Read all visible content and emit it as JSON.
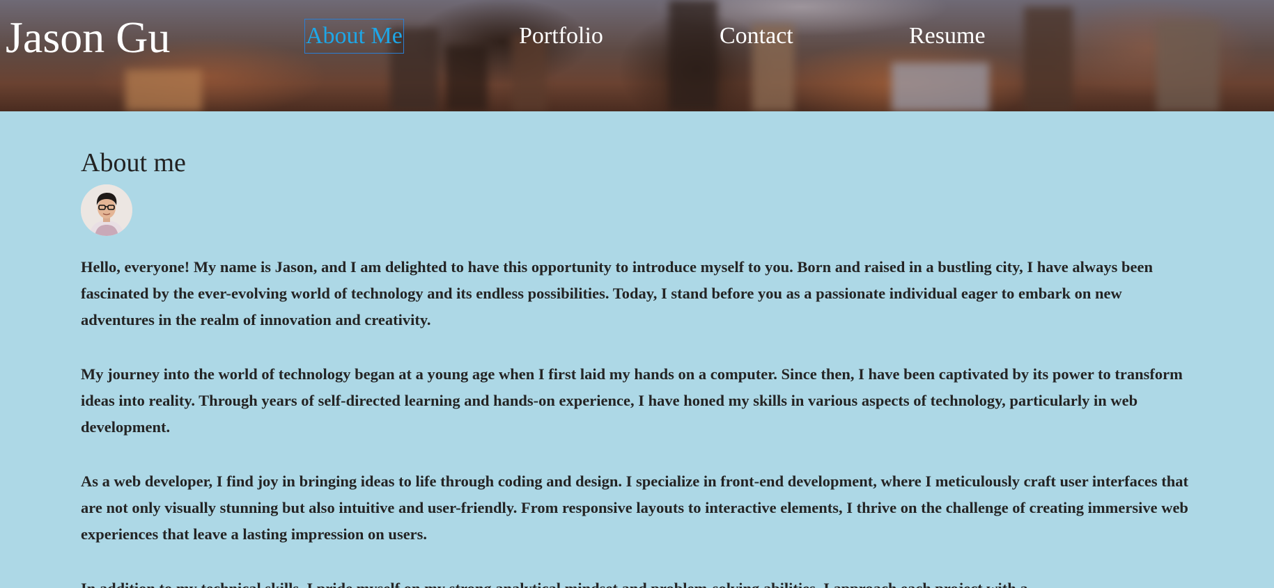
{
  "site": {
    "brand": "Jason Gu"
  },
  "nav": {
    "items": [
      {
        "label": "About Me",
        "active": true
      },
      {
        "label": "Portfolio",
        "active": false
      },
      {
        "label": "Contact",
        "active": false
      },
      {
        "label": "Resume",
        "active": false
      }
    ]
  },
  "about": {
    "title": "About me",
    "avatar_icon": "profile-photo",
    "paragraphs": [
      "Hello, everyone! My name is Jason, and I am delighted to have this opportunity to introduce myself to you. Born and raised in a bustling city, I have always been fascinated by the ever-evolving world of technology and its endless possibilities. Today, I stand before you as a passionate individual eager to embark on new adventures in the realm of innovation and creativity.",
      "My journey into the world of technology began at a young age when I first laid my hands on a computer. Since then, I have been captivated by its power to transform ideas into reality. Through years of self-directed learning and hands-on experience, I have honed my skills in various aspects of technology, particularly in web development.",
      "As a web developer, I find joy in bringing ideas to life through coding and design. I specialize in front-end development, where I meticulously craft user interfaces that are not only visually stunning but also intuitive and user-friendly. From responsive layouts to interactive elements, I thrive on the challenge of creating immersive web experiences that leave a lasting impression on users.",
      "In addition to my technical skills, I pride myself on my strong analytical mindset and problem-solving abilities. I approach each project with a"
    ]
  },
  "colors": {
    "page_background": "#add8e6",
    "nav_active": "#1ea7e8",
    "text": "#242424"
  }
}
